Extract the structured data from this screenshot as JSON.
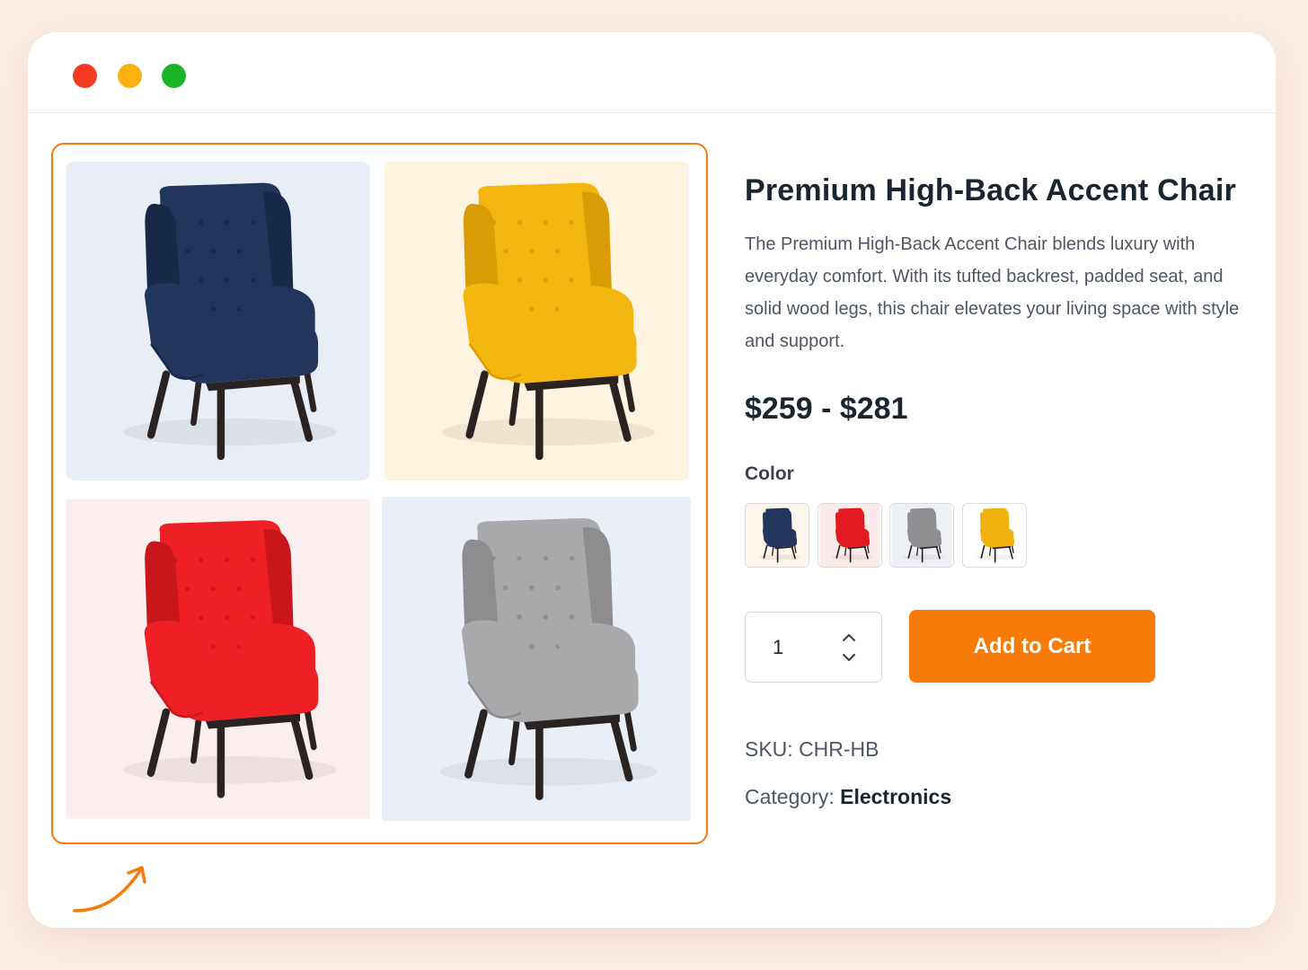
{
  "product": {
    "title": "Premium High-Back Accent Chair",
    "description": "The Premium High-Back Accent Chair blends luxury with everyday comfort. With its tufted backrest, padded seat, and solid wood legs, this chair elevates your living space with style and support.",
    "price_range": "$259 - $281",
    "color_label": "Color",
    "quantity": "1",
    "add_to_cart_label": "Add to Cart",
    "sku": "SKU: CHR-HB",
    "category_prefix": "Category: ",
    "category": "Electronics"
  },
  "gallery": {
    "images": [
      {
        "name": "navy-chair",
        "bg": "#e9eef6",
        "fill": "#22365d",
        "shade": "#182848"
      },
      {
        "name": "yellow-chair",
        "bg": "#fdf3de",
        "fill": "#f3b60e",
        "shade": "#d99c05"
      },
      {
        "name": "red-chair",
        "bg": "#fbeeee",
        "fill": "#ee1f25",
        "shade": "#c9161b"
      },
      {
        "name": "grey-chair",
        "bg": "#eaeff7",
        "fill": "#a9a9ab",
        "shade": "#8d8d90"
      }
    ]
  },
  "swatches": [
    {
      "name": "navy",
      "bg": "#fdf4ea",
      "fill": "#22365d"
    },
    {
      "name": "red",
      "bg": "#fbeaea",
      "fill": "#e21b22"
    },
    {
      "name": "grey",
      "bg": "#edf1f6",
      "fill": "#8f8f92"
    },
    {
      "name": "yellow",
      "bg": "#ffffff",
      "fill": "#f0b20c"
    }
  ],
  "colors": {
    "accent": "#f97b07",
    "page_background": "#fbeee4",
    "gallery_border": "#f47b0e"
  },
  "icons": {
    "qty_up": "chevron-up-icon",
    "qty_down": "chevron-down-icon",
    "arrow": "curved-arrow-icon"
  }
}
